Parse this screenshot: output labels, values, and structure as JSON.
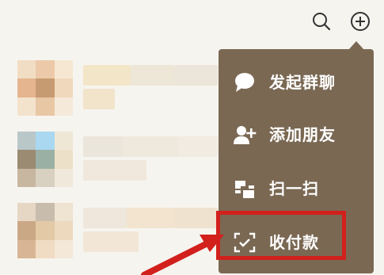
{
  "header": {
    "search_icon": "search-icon",
    "add_icon": "plus-circle-icon"
  },
  "menu": {
    "items": [
      {
        "label": "发起群聊",
        "icon": "chat-bubble-icon"
      },
      {
        "label": "添加朋友",
        "icon": "add-friend-icon"
      },
      {
        "label": "扫一扫",
        "icon": "scan-icon"
      },
      {
        "label": "收付款",
        "icon": "payment-scan-icon"
      }
    ]
  },
  "colors": {
    "menu_background": "#7a6853",
    "highlight_border": "#d2201c",
    "arrow": "#d2201c"
  }
}
